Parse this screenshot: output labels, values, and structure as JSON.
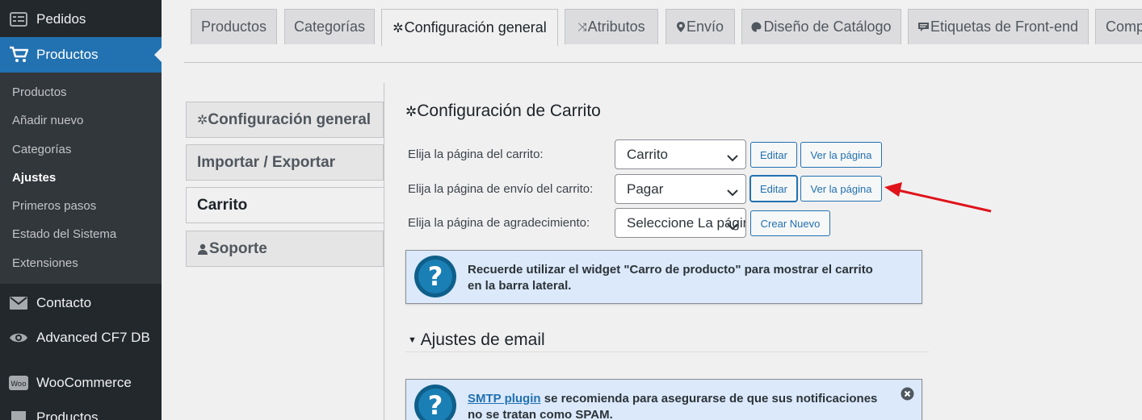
{
  "sidebar": {
    "pedidos": "Pedidos",
    "productos": "Productos",
    "submenu": [
      "Productos",
      "Añadir nuevo",
      "Categorías",
      "Ajustes",
      "Primeros pasos",
      "Estado del Sistema",
      "Extensiones"
    ],
    "contacto": "Contacto",
    "advanced_cf7": "Advanced CF7 DB",
    "woocommerce": "WooCommerce",
    "woo_icon_text": "Woo",
    "productos2": "Productos",
    "current_color": "#2271b1"
  },
  "top_tabs": [
    "Productos",
    "Categorías",
    "Configuración general",
    "Atributos",
    "Envío",
    "Diseño de Catálogo",
    "Etiquetas de Front-end",
    "Comp"
  ],
  "side_tabs": [
    "Configuración general",
    "Importar / Exportar",
    "Carrito",
    "Soporte"
  ],
  "cart": {
    "title": "Configuración de Carrito",
    "rows": [
      {
        "label": "Elija la página del carrito:",
        "value": "Carrito",
        "btn1": "Editar",
        "btn2": "Ver la página"
      },
      {
        "label": "Elija la página de envío del carrito:",
        "value": "Pagar",
        "btn1": "Editar",
        "btn2": "Ver la página"
      },
      {
        "label": "Elija la página de agradecimiento:",
        "value": "Seleccione La página",
        "btn1": "Crear Nuevo"
      }
    ],
    "notice": "Recuerde utilizar el widget \"Carro de producto\" para mostrar el carrito en la barra lateral."
  },
  "email": {
    "title": "Ajustes de email",
    "notice_link": "SMTP plugin",
    "notice_text": " se recomienda para asegurarse de que sus notificaciones no se tratan como SPAM."
  },
  "colors": {
    "annotation_arrow": "#e0131a",
    "notice_bg": "#dbe9fb"
  }
}
